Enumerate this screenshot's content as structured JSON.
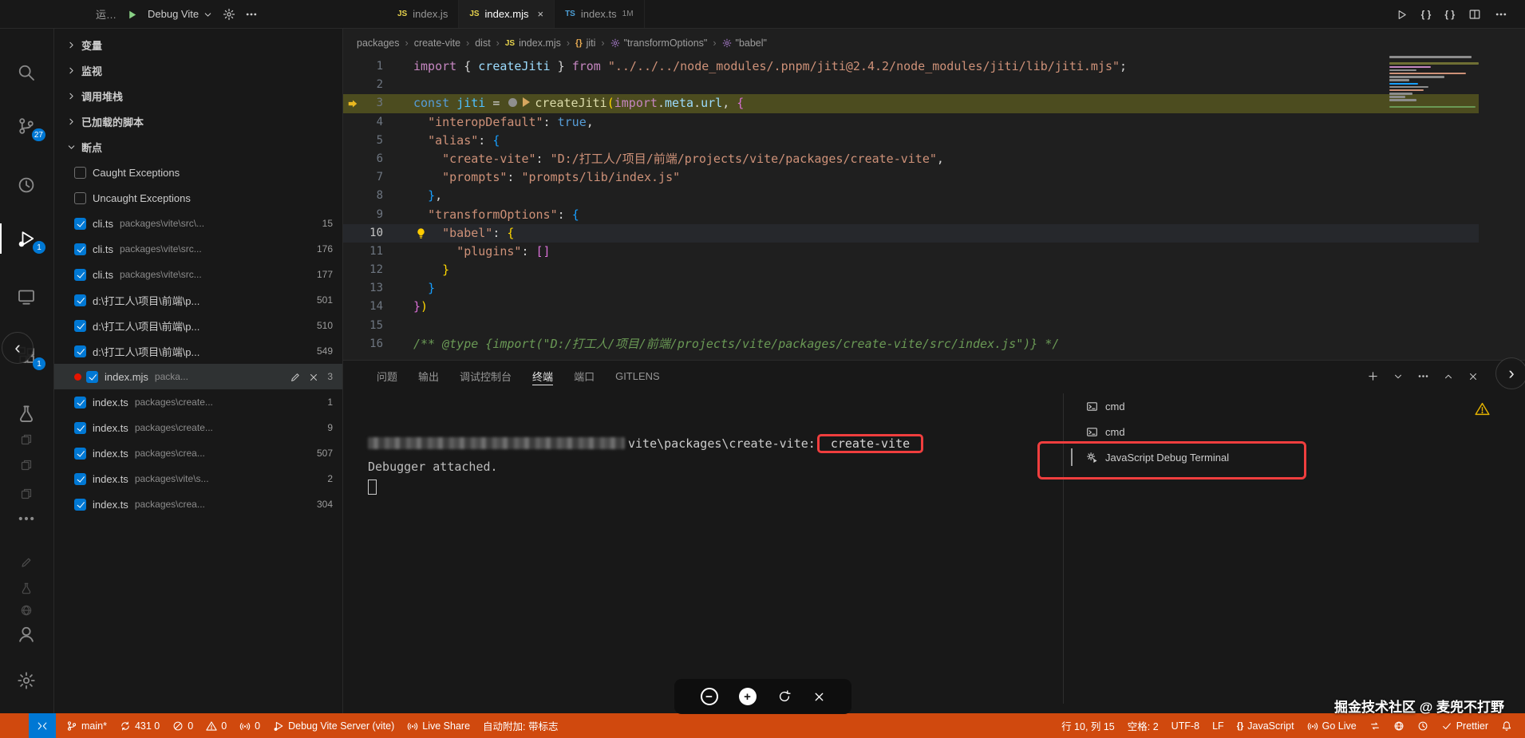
{
  "window": {
    "topbar": {
      "left_label": "运…",
      "debug_config": "Debug Vite",
      "tabs": [
        {
          "icon": "JS",
          "label": "index.js",
          "active": false,
          "badge": ""
        },
        {
          "icon": "JS",
          "label": "index.mjs",
          "active": true,
          "badge": ""
        },
        {
          "icon": "TS",
          "label": "index.ts",
          "active": false,
          "badge": "1M"
        }
      ]
    }
  },
  "activity_bar": {
    "items": [
      {
        "name": "explorer",
        "icon": "files",
        "badge": "",
        "active": false,
        "dim": false
      },
      {
        "name": "search",
        "icon": "search",
        "badge": "",
        "active": false,
        "dim": false
      },
      {
        "name": "source-control",
        "icon": "branch",
        "badge": "27",
        "active": false,
        "dim": false
      },
      {
        "name": "timeline-history",
        "icon": "history",
        "badge": "",
        "active": false,
        "dim": false
      },
      {
        "name": "run-and-debug",
        "icon": "debug",
        "badge": "1",
        "active": true,
        "dim": false
      },
      {
        "name": "remote-explorer",
        "icon": "monitor",
        "badge": "",
        "active": false,
        "dim": false
      },
      {
        "name": "extensions",
        "icon": "extensions",
        "badge": "1",
        "active": false,
        "dim": false
      },
      {
        "name": "testing",
        "icon": "beaker",
        "badge": "",
        "active": false,
        "dim": false
      },
      {
        "name": "doc-shortcut-1",
        "icon": "files",
        "badge": "",
        "active": false,
        "dim": true
      },
      {
        "name": "doc-shortcut-2",
        "icon": "files",
        "badge": "",
        "active": false,
        "dim": true
      },
      {
        "name": "doc-shortcut-3",
        "icon": "files",
        "badge": "",
        "active": false,
        "dim": true
      },
      {
        "name": "more-views",
        "icon": "ellipsis",
        "badge": "",
        "active": false,
        "dim": false
      },
      {
        "name": "pencil-shortcut",
        "icon": "pencil",
        "badge": "",
        "active": false,
        "dim": true
      },
      {
        "name": "beaker-shortcut",
        "icon": "beaker",
        "badge": "",
        "active": false,
        "dim": true
      },
      {
        "name": "globe-shortcut",
        "icon": "globe",
        "badge": "",
        "active": false,
        "dim": true
      },
      {
        "name": "accounts",
        "icon": "account",
        "badge": "",
        "active": false,
        "dim": false
      },
      {
        "name": "settings",
        "icon": "gear",
        "badge": "",
        "active": false,
        "dim": false
      }
    ]
  },
  "sidebar": {
    "sections": [
      {
        "label": "变量",
        "expanded": false
      },
      {
        "label": "监视",
        "expanded": false
      },
      {
        "label": "调用堆栈",
        "expanded": false
      },
      {
        "label": "已加载的脚本",
        "expanded": false
      },
      {
        "label": "断点",
        "expanded": true
      }
    ],
    "exceptions": [
      {
        "label": "Caught Exceptions",
        "checked": false
      },
      {
        "label": "Uncaught Exceptions",
        "checked": false
      }
    ],
    "breakpoints": [
      {
        "file": "cli.ts",
        "path": "packages\\vite\\src\\...",
        "line": "15",
        "selected": false
      },
      {
        "file": "cli.ts",
        "path": "packages\\vite\\src...",
        "line": "176",
        "selected": false
      },
      {
        "file": "cli.ts",
        "path": "packages\\vite\\src...",
        "line": "177",
        "selected": false
      },
      {
        "file": "d:\\打工人\\项目\\前端\\p...",
        "path": "",
        "line": "501",
        "selected": false
      },
      {
        "file": "d:\\打工人\\项目\\前端\\p...",
        "path": "",
        "line": "510",
        "selected": false
      },
      {
        "file": "d:\\打工人\\项目\\前端\\p...",
        "path": "",
        "line": "549",
        "selected": false
      },
      {
        "file": "index.mjs",
        "path": "packa...",
        "line": "3",
        "selected": true
      },
      {
        "file": "index.ts",
        "path": "packages\\create...",
        "line": "1",
        "selected": false
      },
      {
        "file": "index.ts",
        "path": "packages\\create...",
        "line": "9",
        "selected": false
      },
      {
        "file": "index.ts",
        "path": "packages\\crea...",
        "line": "507",
        "selected": false
      },
      {
        "file": "index.ts",
        "path": "packages\\vite\\s...",
        "line": "2",
        "selected": false
      },
      {
        "file": "index.ts",
        "path": "packages\\crea...",
        "line": "304",
        "selected": false
      }
    ]
  },
  "editor": {
    "breadcrumbs": [
      {
        "label": "packages",
        "icon": ""
      },
      {
        "label": "create-vite",
        "icon": ""
      },
      {
        "label": "dist",
        "icon": ""
      },
      {
        "label": "index.mjs",
        "icon": "JS"
      },
      {
        "label": "jiti",
        "icon": "braces"
      },
      {
        "label": "\"transformOptions\"",
        "icon": "wrench"
      },
      {
        "label": "\"babel\"",
        "icon": "wrench"
      }
    ],
    "debug_line": 3,
    "cursor_line": 10,
    "lines": [
      [
        [
          "kw",
          "import"
        ],
        [
          "pln",
          " { "
        ],
        [
          "var",
          "createJiti"
        ],
        [
          "pln",
          " } "
        ],
        [
          "kw",
          "from"
        ],
        [
          "pln",
          " "
        ],
        [
          "str",
          "\"../../../node_modules/.pnpm/jiti@2.4.2/node_modules/jiti/lib/jiti.mjs\""
        ],
        [
          "pln",
          ";"
        ]
      ],
      [],
      [
        [
          "const",
          "const"
        ],
        [
          "pln",
          " "
        ],
        [
          "var2",
          "jiti"
        ],
        [
          "pln",
          " = "
        ],
        [
          "icon",
          "step-dot"
        ],
        [
          "icon",
          "step-play"
        ],
        [
          "fn",
          "createJiti"
        ],
        [
          "br1",
          "("
        ],
        [
          "kw",
          "import"
        ],
        [
          "pln",
          "."
        ],
        [
          "var",
          "meta"
        ],
        [
          "pln",
          "."
        ],
        [
          "var",
          "url"
        ],
        [
          "pln",
          ", "
        ],
        [
          "br2",
          "{"
        ]
      ],
      [
        [
          "pln",
          "  "
        ],
        [
          "str",
          "\"interopDefault\""
        ],
        [
          "pln",
          ": "
        ],
        [
          "const",
          "true"
        ],
        [
          "pln",
          ","
        ]
      ],
      [
        [
          "pln",
          "  "
        ],
        [
          "str",
          "\"alias\""
        ],
        [
          "pln",
          ": "
        ],
        [
          "br3",
          "{"
        ]
      ],
      [
        [
          "pln",
          "    "
        ],
        [
          "str",
          "\"create-vite\""
        ],
        [
          "pln",
          ": "
        ],
        [
          "str",
          "\"D:/打工人/项目/前端/projects/vite/packages/create-vite\""
        ],
        [
          "pln",
          ","
        ]
      ],
      [
        [
          "pln",
          "    "
        ],
        [
          "str",
          "\"prompts\""
        ],
        [
          "pln",
          ": "
        ],
        [
          "str",
          "\"prompts/lib/index.js\""
        ]
      ],
      [
        [
          "pln",
          "  "
        ],
        [
          "br3",
          "}"
        ],
        [
          "pln",
          ","
        ]
      ],
      [
        [
          "pln",
          "  "
        ],
        [
          "str",
          "\"transformOptions\""
        ],
        [
          "pln",
          ": "
        ],
        [
          "br3",
          "{"
        ]
      ],
      [
        [
          "pln",
          "    "
        ],
        [
          "str",
          "\"babel\""
        ],
        [
          "pln",
          ": "
        ],
        [
          "br1",
          "{"
        ]
      ],
      [
        [
          "pln",
          "      "
        ],
        [
          "str",
          "\"plugins\""
        ],
        [
          "pln",
          ": "
        ],
        [
          "br2",
          "[]"
        ]
      ],
      [
        [
          "pln",
          "    "
        ],
        [
          "br1",
          "}"
        ]
      ],
      [
        [
          "pln",
          "  "
        ],
        [
          "br3",
          "}"
        ]
      ],
      [
        [
          "br2",
          "}"
        ],
        [
          "br1",
          ")"
        ]
      ],
      [],
      [
        [
          "cmt",
          "/** @type {import(\"D:/打工人/项目/前端/projects/vite/packages/create-vite/src/index.js\")} */"
        ]
      ]
    ]
  },
  "panel": {
    "tabs": [
      {
        "label": "问题",
        "active": false
      },
      {
        "label": "输出",
        "active": false
      },
      {
        "label": "调试控制台",
        "active": false
      },
      {
        "label": "终端",
        "active": true
      },
      {
        "label": "端口",
        "active": false
      },
      {
        "label": "GITLENS",
        "active": false
      }
    ],
    "terminal": {
      "prompt_visible": "vite\\packages\\create-vite:",
      "highlight_text": "create-vite",
      "line2": "Debugger attached."
    },
    "terminal_list": [
      {
        "icon": "terminal",
        "label": "cmd",
        "selected": false
      },
      {
        "icon": "terminal",
        "label": "cmd",
        "selected": false
      },
      {
        "icon": "debug-gear",
        "label": "JavaScript Debug Terminal",
        "selected": true
      }
    ]
  },
  "status_bar": {
    "left": [
      {
        "name": "remote",
        "icon": "remoteArrows",
        "label": ""
      },
      {
        "name": "branch",
        "icon": "branch",
        "label": "main*"
      },
      {
        "name": "sync",
        "icon": "sync",
        "label": "431 0"
      },
      {
        "name": "errors",
        "icon": "errorCircle",
        "label": "0"
      },
      {
        "name": "warnings",
        "icon": "warning",
        "label": "0"
      },
      {
        "name": "ports",
        "icon": "broadcast",
        "label": "0"
      },
      {
        "name": "debug-session",
        "icon": "debug",
        "label": "Debug Vite Server (vite)"
      },
      {
        "name": "live-share",
        "icon": "broadcast",
        "label": "Live Share"
      },
      {
        "name": "auto-attach",
        "icon": "",
        "label": "自动附加: 带标志"
      }
    ],
    "right": [
      {
        "name": "cursor-position",
        "icon": "",
        "label": "行 10, 列 15"
      },
      {
        "name": "indentation",
        "icon": "",
        "label": "空格: 2"
      },
      {
        "name": "encoding",
        "icon": "",
        "label": "UTF-8"
      },
      {
        "name": "eol",
        "icon": "",
        "label": "LF"
      },
      {
        "name": "language-mode",
        "icon": "bracesText",
        "label": "JavaScript"
      },
      {
        "name": "go-live",
        "icon": "broadcast",
        "label": "Go Live"
      },
      {
        "name": "sync-alt",
        "icon": "compare",
        "label": ""
      },
      {
        "name": "browser-preview",
        "icon": "globe",
        "label": ""
      },
      {
        "name": "session-time",
        "icon": "history",
        "label": ""
      },
      {
        "name": "prettier",
        "icon": "check",
        "label": "Prettier"
      },
      {
        "name": "notifications",
        "icon": "bell",
        "label": ""
      }
    ]
  },
  "overlays": {
    "watermark": "掘金技术社区 @ 麦兜不打野",
    "nav_left": "‹",
    "nav_right": "›"
  }
}
